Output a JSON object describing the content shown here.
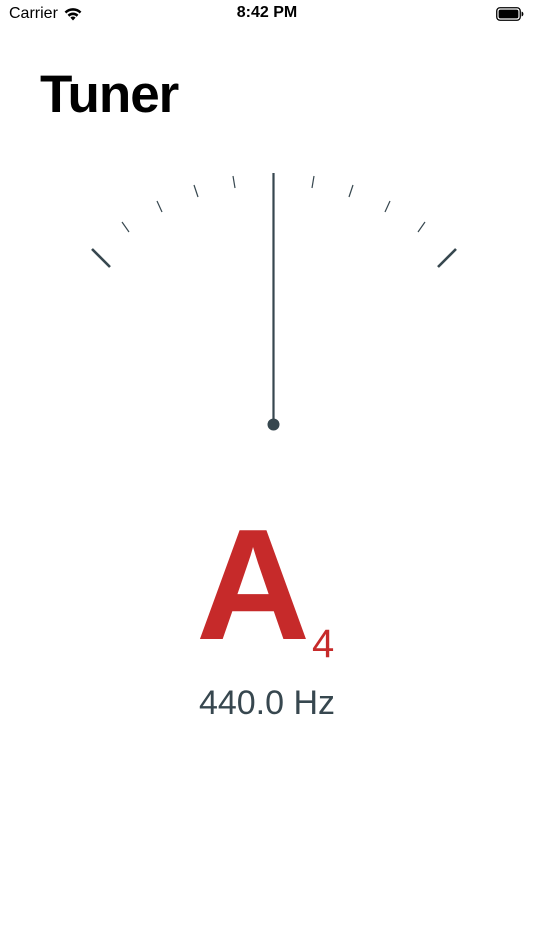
{
  "status_bar": {
    "carrier": "Carrier",
    "time": "8:42 PM",
    "wifi_icon": "wifi-icon",
    "battery_icon": "battery-icon"
  },
  "header": {
    "title": "Tuner"
  },
  "meter": {
    "cents_deviation": 0,
    "needle_color": "#37474f",
    "tick_color": "#37474f"
  },
  "note": {
    "name": "A",
    "octave": "4",
    "color": "#c62a2a"
  },
  "frequency": {
    "text": "440.0 Hz"
  }
}
